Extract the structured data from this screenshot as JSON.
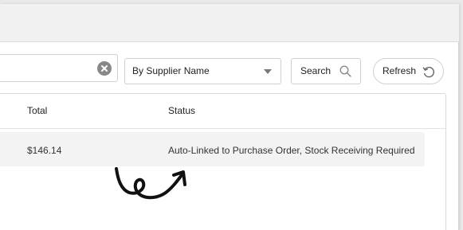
{
  "search": {
    "value": "",
    "clear_icon": "clear-circle-icon"
  },
  "filter": {
    "selected": "By Supplier Name"
  },
  "toolbar": {
    "search_label": "Search",
    "refresh_label": "Refresh"
  },
  "table": {
    "columns": [
      "Total",
      "Status"
    ],
    "rows": [
      {
        "total": "$146.14",
        "status": "Auto-Linked to Purchase Order, Stock Receiving Required"
      }
    ]
  },
  "colors": {
    "row_highlight": "#f3f3f3",
    "border": "#cfcfcf",
    "clear_icon": "#888888"
  }
}
